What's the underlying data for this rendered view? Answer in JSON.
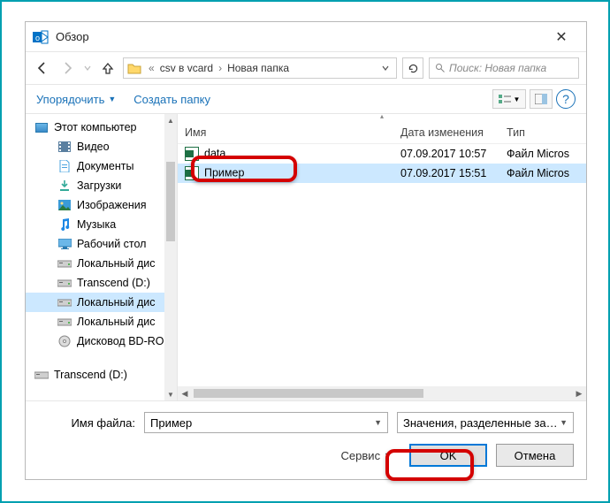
{
  "window": {
    "title": "Обзор",
    "close_symbol": "✕"
  },
  "nav": {
    "crumb1": "csv в vcard",
    "crumb2": "Новая папка",
    "search_placeholder": "Поиск: Новая папка"
  },
  "toolbar": {
    "organize": "Упорядочить",
    "new_folder": "Создать папку",
    "help_symbol": "?"
  },
  "sidebar": {
    "this_pc": "Этот компьютер",
    "items": [
      {
        "label": "Видео",
        "icon": "film-icon",
        "color": "#5a7fa0"
      },
      {
        "label": "Документы",
        "icon": "document-icon",
        "color": "#4aa3df"
      },
      {
        "label": "Загрузки",
        "icon": "download-icon",
        "color": "#4a9"
      },
      {
        "label": "Изображения",
        "icon": "image-icon",
        "color": "#3a9bd8"
      },
      {
        "label": "Музыка",
        "icon": "music-icon",
        "color": "#1e88e5"
      },
      {
        "label": "Рабочий стол",
        "icon": "desktop-icon",
        "color": "#2a7ab0"
      },
      {
        "label": "Локальный дис",
        "icon": "drive-icon",
        "color": "#888"
      },
      {
        "label": "Transcend (D:)",
        "icon": "drive-icon",
        "color": "#888"
      },
      {
        "label": "Локальный дис",
        "icon": "drive-icon",
        "color": "#888",
        "selected": true
      },
      {
        "label": "Локальный дис",
        "icon": "drive-icon",
        "color": "#888"
      },
      {
        "label": "Дисковод BD-RО",
        "icon": "disc-icon",
        "color": "#777"
      }
    ],
    "network_item": "Transcend (D:)"
  },
  "filelist": {
    "headers": {
      "name": "Имя",
      "date": "Дата изменения",
      "type": "Тип"
    },
    "rows": [
      {
        "name": "data",
        "date": "07.09.2017 10:57",
        "type": "Файл Micros"
      },
      {
        "name": "Пример",
        "date": "07.09.2017 15:51",
        "type": "Файл Micros",
        "selected": true
      }
    ]
  },
  "bottom": {
    "filename_label": "Имя файла:",
    "filename_value": "Пример",
    "filter_value": "Значения, разделенные запят",
    "tools_label": "Сервис",
    "ok_label": "OK",
    "cancel_label": "Отмена"
  }
}
